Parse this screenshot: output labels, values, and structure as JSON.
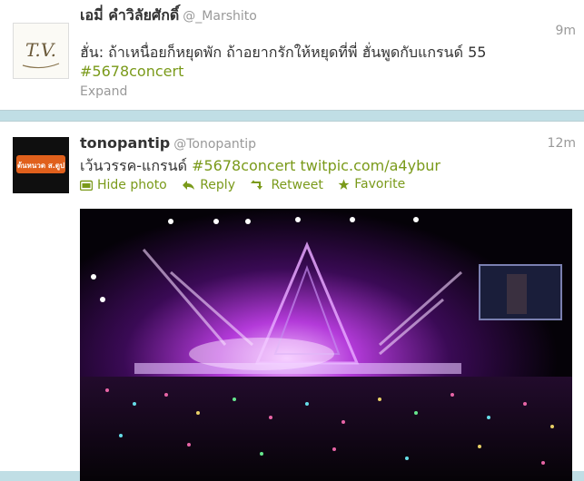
{
  "tweets": [
    {
      "display_name": "เอมี่ คำวิลัยศักดิ์",
      "handle": "@_Marshito",
      "time": "9m",
      "text": "ฮั่น: ถ้าเหนื่อยก็หยุดพัก ถ้าอยากรักให้หยุดที่พี่ ฮั่นพูดกับแกรนด์ 55",
      "hashtag": "#5678concert",
      "expand_label": "Expand",
      "avatar_text": "T.V."
    },
    {
      "display_name": "tonopantip",
      "handle": "@Tonopantip",
      "time": "12m",
      "text": "เว้นวรรค-แกรนด์",
      "hashtag": "#5678concert",
      "link": "twitpic.com/a4ybur",
      "avatar_text": "ต้นหนวด ส.ตูป",
      "actions": {
        "hide_photo": "Hide photo",
        "reply": "Reply",
        "retweet": "Retweet",
        "favorite": "Favorite"
      }
    }
  ],
  "colors": {
    "link": "#7a9a1a",
    "background": "#c0dee5",
    "muted": "#999999"
  }
}
